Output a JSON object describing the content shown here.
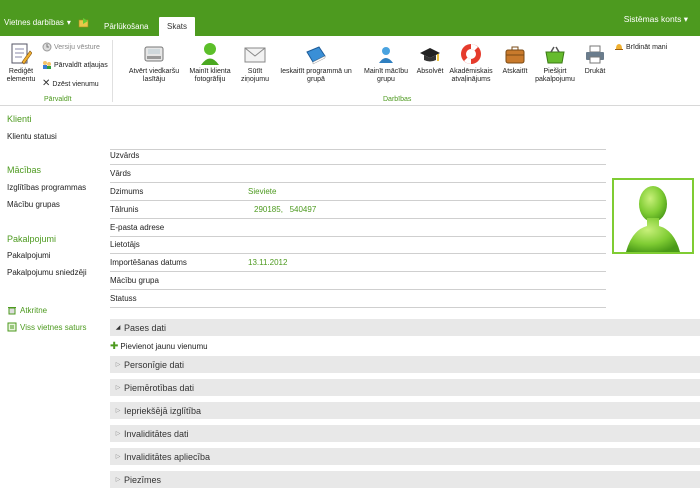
{
  "topbar": {
    "site_actions": "Vietnes darbības",
    "tab_browse": "Pārlūkošana",
    "tab_view": "Skats",
    "account": "Sistēmas konts"
  },
  "ribbon": {
    "manage": {
      "edit_item": "Rediģēt elementu",
      "version_history": "Versiju vēsture",
      "manage_alerts": "Pārvaldīt atļaujas",
      "delete_item": "Dzēst vienumu",
      "group_label": "Pārvaldīt"
    },
    "actions": {
      "open_card": "Atvērt viedkaršu lasītāju",
      "change_photo": "Mainīt klienta fotogrāfiju",
      "send_message": "Sūtīt ziņojumu",
      "include_program": "Ieskaitīt programmā un grupā",
      "change_group": "Mainīt mācību grupu",
      "graduated": "Absolvēt",
      "academic_leave": "Akadēmiskais atvaļinājums",
      "withdraw": "Atskaitīt",
      "assign_service": "Piešķirt pakalpojumu",
      "print": "Drukāt",
      "alert_me": "Brīdināt mani",
      "group_label": "Darbības"
    }
  },
  "leftnav": {
    "clients_heading": "Klienti",
    "client_statuses": "Klientu statusi",
    "learning_heading": "Mācības",
    "programs": "Izglītības programmas",
    "groups": "Mācību grupas",
    "services_heading": "Pakalpojumi",
    "services": "Pakalpojumi",
    "providers": "Pakalpojumu sniedzēji",
    "recycle_bin": "Atkritne",
    "all_content": "Viss vietnes saturs"
  },
  "form": {
    "surname": {
      "label": "Uzvārds",
      "value": ""
    },
    "name": {
      "label": "Vārds",
      "value": ""
    },
    "gender": {
      "label": "Dzimums",
      "value": "Sieviete"
    },
    "phone": {
      "label": "Tālrunis",
      "value": "290185,   540497"
    },
    "email": {
      "label": "E-pasta adrese",
      "value": ""
    },
    "user": {
      "label": "Lietotājs",
      "value": ""
    },
    "import_date": {
      "label": "Importēšanas datums",
      "value": "13.11.2012"
    },
    "study_group": {
      "label": "Mācību grupa",
      "value": ""
    },
    "status": {
      "label": "Statuss",
      "value": ""
    }
  },
  "sections": {
    "passport": "Pases dati",
    "add_new": "Pievienot jaunu vienumu",
    "personal": "Personīgie dati",
    "suitability": "Piemērotības dati",
    "previous_education": "Iepriekšējā izglītība",
    "disability": "Invaliditātes dati",
    "disability_certificate": "Invaliditātes apliecība",
    "notes": "Piezīmes"
  },
  "colors": {
    "brand_green": "#4d9a1f",
    "accent_green": "#7fcc33",
    "section_bg": "#e8e8e8"
  }
}
